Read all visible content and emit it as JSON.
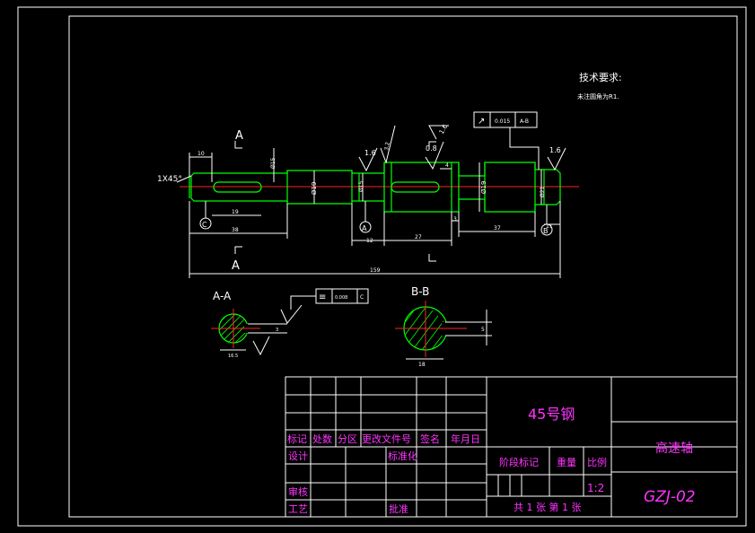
{
  "tech": {
    "title": "技术要求:",
    "note": "未注圆角为R1."
  },
  "sections": {
    "a_top": "A",
    "a_bottom": "A",
    "aa_label": "A-A",
    "bb_label": "B-B",
    "c": "C",
    "b": "B"
  },
  "dims": {
    "chamfer": "1X45°",
    "d10": "10",
    "d19": "19",
    "d38": "38",
    "d12": "12",
    "d27": "27",
    "d37": "37",
    "d4": "4",
    "d3": "3",
    "d11": "11",
    "d159": "159",
    "dia1": "Ø19",
    "dia2": "Ø19",
    "dia3": "Ø15",
    "dia4": "Ø15",
    "dia5": "Ø21",
    "aa_dim1": "3",
    "aa_dim2": "16.5",
    "bb_dim1": "5",
    "bb_dim2": "18"
  },
  "roughness": {
    "r1": "1.6",
    "r2": "1.6",
    "r3": "0.8",
    "r4": "1.6",
    "r5": "3.2",
    "r6": "1.6"
  },
  "tolerance": {
    "runout_symbol": "↗",
    "runout_value": "0.015",
    "runout_datum": "A-B",
    "sym_symbol": "≡",
    "sym_value": "0.008",
    "sym_datum": "C"
  },
  "title_block": {
    "material": "45号钢",
    "part_name": "高速轴",
    "drawing_no": "GZJ-02",
    "scale": "1:2",
    "sheets": "共 1 张 第 1 张",
    "headers": [
      "标记",
      "处数",
      "分区",
      "更改文件号",
      "签名",
      "年月日"
    ],
    "design": "设计",
    "standardize": "标准化",
    "stage_mark": "阶段标记",
    "weight": "重量",
    "scale_label": "比例",
    "review": "审核",
    "process": "工艺",
    "approve": "批准"
  }
}
